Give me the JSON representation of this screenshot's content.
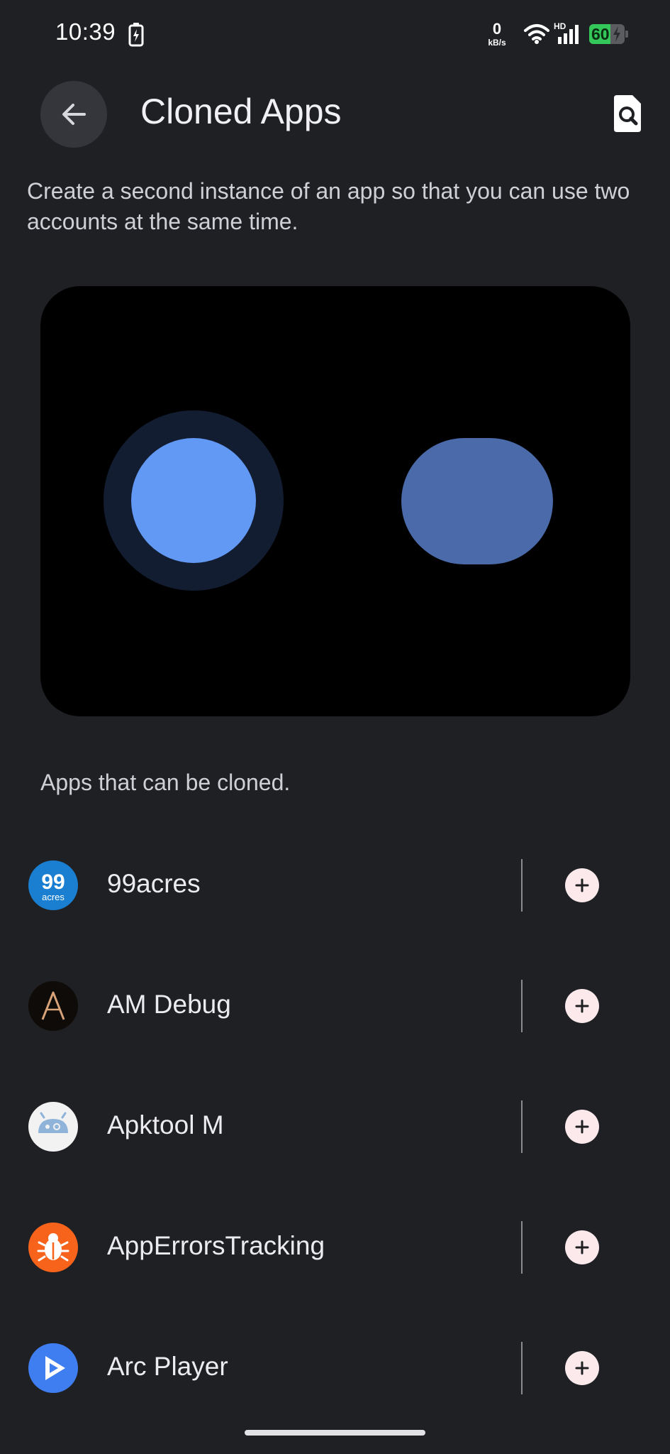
{
  "status_bar": {
    "time": "10:39",
    "net_speed_value": "0",
    "net_speed_unit": "kB/s",
    "hd_label": "HD",
    "battery_level": "60",
    "battery_color": "#34c759"
  },
  "header": {
    "title": "Cloned Apps",
    "back_icon": "arrow-back-icon",
    "search_icon": "search-page-icon"
  },
  "description": "Create a second instance of an app so that you can use two accounts at the same time.",
  "illustration": {
    "circle_color": "#6299f5",
    "ring_color": "#131d31",
    "pill_color": "#4a6aaa"
  },
  "section_header": "Apps that can be cloned.",
  "apps": [
    {
      "name": "99acres",
      "icon": "99acres-app-icon",
      "icon_text": "99",
      "icon_subtext": "acres"
    },
    {
      "name": "AM Debug",
      "icon": "am-debug-app-icon"
    },
    {
      "name": "Apktool M",
      "icon": "apktool-m-app-icon"
    },
    {
      "name": "AppErrorsTracking",
      "icon": "app-errors-tracking-app-icon"
    },
    {
      "name": "Arc Player",
      "icon": "arc-player-app-icon"
    }
  ],
  "add_icon": "plus-icon",
  "colors": {
    "background": "#1f2024",
    "add_button": "#fbe9ec"
  }
}
